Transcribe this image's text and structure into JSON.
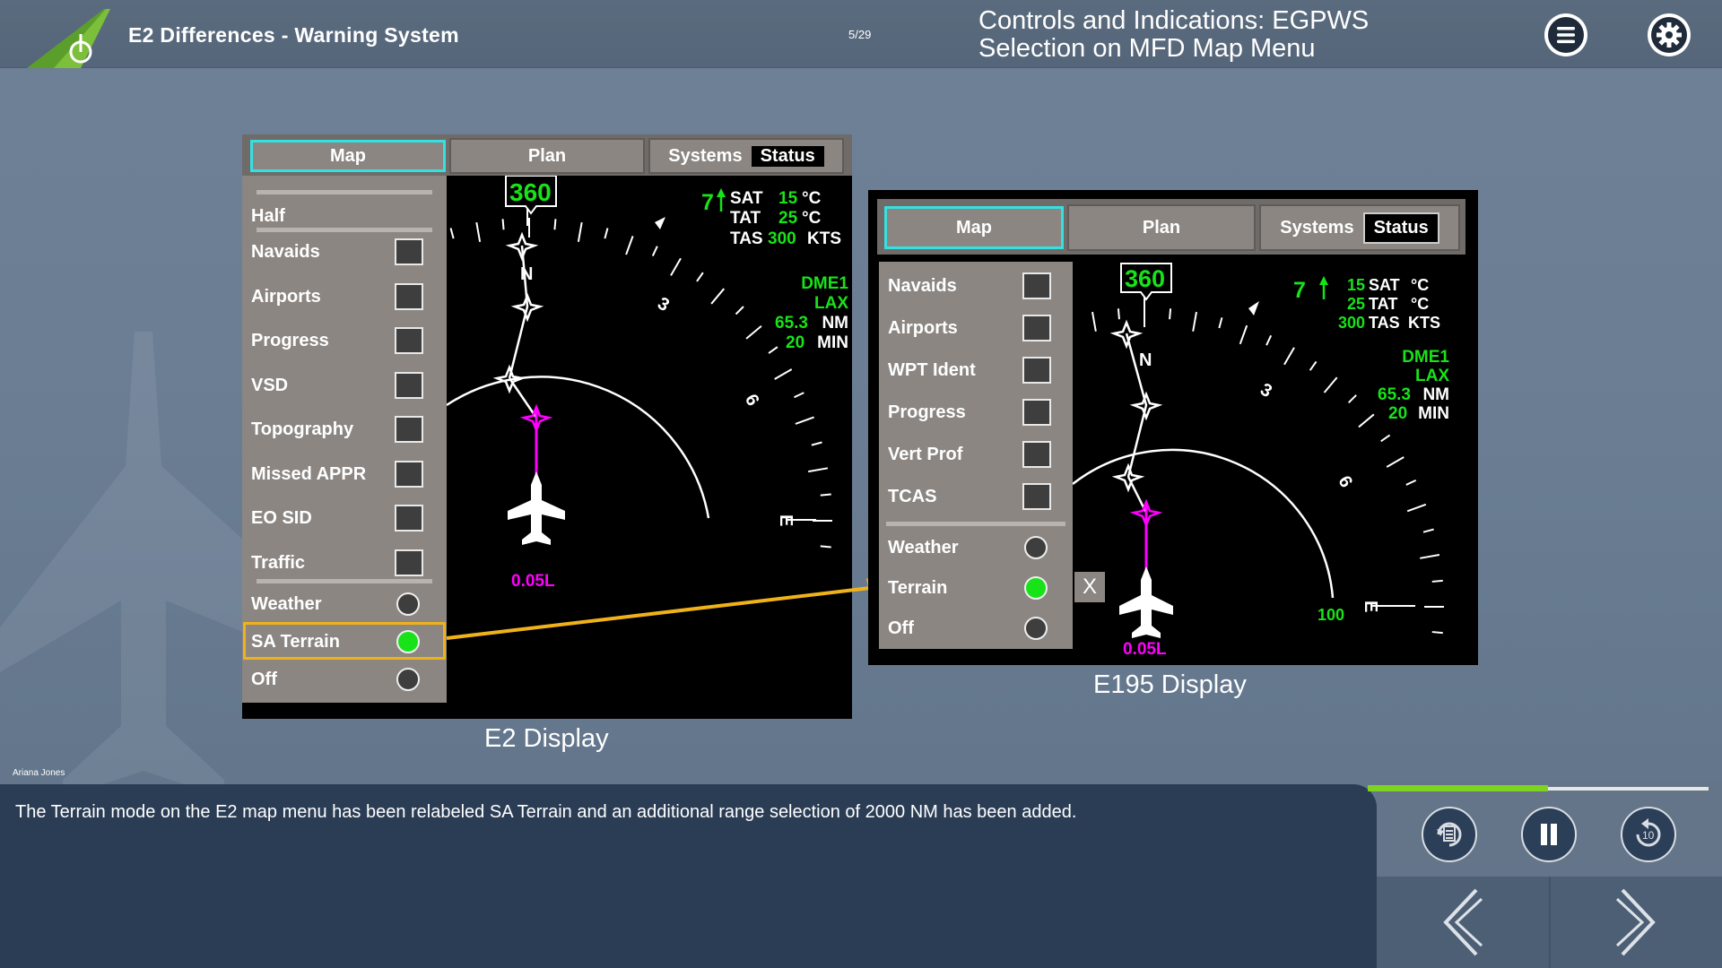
{
  "header": {
    "course_title": "E2 Differences - Warning System",
    "page_counter": "5/29",
    "topic_title_line1": "Controls and Indications: EGPWS",
    "topic_title_line2": "Selection on MFD Map Menu"
  },
  "e2": {
    "caption": "E2 Display",
    "tabs": [
      "Map",
      "Plan",
      "Systems"
    ],
    "status_label": "Status",
    "half_label": "Half",
    "checkbox_items": [
      "Navaids",
      "Airports",
      "Progress",
      "VSD",
      "Topography",
      "Missed APPR",
      "EO SID",
      "Traffic"
    ],
    "radio_items": [
      "Weather",
      "SA Terrain",
      "Off"
    ],
    "selected_radio": "SA Terrain",
    "hsi": {
      "heading": "360",
      "wind": "7",
      "sat_label": "SAT",
      "sat_value": "15",
      "sat_unit": "°C",
      "tat_label": "TAT",
      "tat_value": "25",
      "tat_unit": "°C",
      "tas_label": "TAS",
      "tas_value": "300",
      "tas_unit": "KTS",
      "nav_source": "DME1",
      "nav_dest": "LAX",
      "nav_dist_value": "65.3",
      "nav_dist_unit": "NM",
      "nav_time_value": "20",
      "nav_time_unit": "MIN",
      "compass_n": "N",
      "compass_3": "3",
      "compass_6": "6",
      "compass_e": "E",
      "range_value": "0.05L"
    }
  },
  "e195": {
    "caption": "E195 Display",
    "tabs": [
      "Map",
      "Plan",
      "Systems"
    ],
    "status_label": "Status",
    "checkbox_items": [
      "Navaids",
      "Airports",
      "WPT Ident",
      "Progress",
      "Vert Prof",
      "TCAS"
    ],
    "radio_items": [
      "Weather",
      "Terrain",
      "Off"
    ],
    "selected_radio": "Terrain",
    "close_label": "X",
    "hsi": {
      "heading": "360",
      "wind": "7",
      "sat_label": "SAT",
      "sat_value": "15",
      "sat_unit": "°C",
      "tat_label": "TAT",
      "tat_value": "25",
      "tat_unit": "°C",
      "tas_label": "TAS",
      "tas_value": "300",
      "tas_unit": "KTS",
      "nav_source": "DME1",
      "nav_dest": "LAX",
      "nav_dist_value": "65.3",
      "nav_dist_unit": "NM",
      "nav_time_value": "20",
      "nav_time_unit": "MIN",
      "compass_n": "N",
      "compass_3": "3",
      "compass_6": "6",
      "compass_e": "E",
      "range_value": "0.05L",
      "range_ring_label": "100"
    }
  },
  "footer": {
    "narrator": "Ariana Jones",
    "transcript": "The Terrain mode on the E2 map menu has been relabeled SA Terrain and an additional range selection of 2000 NM has been added.",
    "progress": 0.53
  },
  "colors": {
    "accent_green": "#18e318",
    "highlight_orange": "#f0b21a",
    "route_magenta": "#ff00ff",
    "tab_active_border": "#35e0e0",
    "transcript_bg": "#2b3d55"
  }
}
